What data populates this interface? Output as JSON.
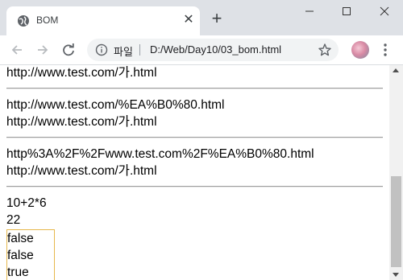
{
  "tab": {
    "title": "BOM",
    "icon": "globe-icon"
  },
  "toolbar": {
    "site_info_label": "파일",
    "url": "D:/Web/Day10/03_bom.html"
  },
  "content": {
    "block1": [
      "http://www.test.com/가.html"
    ],
    "block2": [
      "http://www.test.com/%EA%B0%80.html",
      "http://www.test.com/가.html"
    ],
    "block3": [
      "http%3A%2F%2Fwww.test.com%2F%EA%B0%80.html",
      "http://www.test.com/가.html"
    ],
    "block4": [
      "10+2*6",
      "22"
    ],
    "boxed": [
      "false",
      "false",
      "true"
    ]
  },
  "colors": {
    "box_border": "#e6b84c",
    "chrome_bg": "#dee1e6"
  }
}
